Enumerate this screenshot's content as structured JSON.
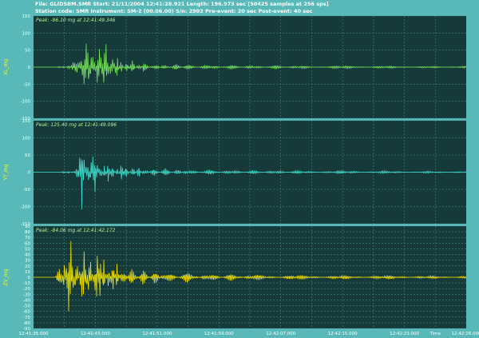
{
  "header": {
    "line1": "File: GLIDSBM.SMR  Start: 21/11/2004 12:41:28.921 Length: 196.973 sec [50425 samples at 256 sps]",
    "line2": "Station code: SMR  Instrument: SM-2 (00.06.00)  S/n: 2902  Pre-event: 20 sec  Post-event: 40 sec"
  },
  "colors": {
    "background": "#59b8b8",
    "panel": "#163a3a",
    "grid": "#3f8585",
    "xl": "#79e35c",
    "yt": "#40e0d0",
    "zv": "#f2e200",
    "label": "#eaff3a",
    "peak_text": "#b8f08a"
  },
  "chart_data": [
    {
      "type": "line",
      "ylabel": "XL_mg",
      "annotation": "Peak: -96.10 mg at 12:41:49.346",
      "ylim": [
        -150,
        150
      ],
      "yticks": [
        150,
        100,
        50,
        0,
        -50,
        -100,
        -150
      ],
      "series": [
        {
          "x": [
            0,
            10,
            12,
            14,
            16,
            18,
            19,
            20,
            21,
            22,
            23,
            24,
            25,
            26,
            27,
            28,
            29,
            30,
            31,
            32,
            33,
            34,
            35,
            36,
            37,
            38,
            40,
            42,
            45,
            48,
            50,
            55,
            60,
            65,
            70,
            80,
            90,
            100,
            110,
            120,
            140,
            160,
            180,
            197
          ],
          "y": [
            0,
            0,
            2,
            -5,
            10,
            -14,
            22,
            -45,
            42,
            -96,
            75,
            -80,
            85,
            -70,
            60,
            -80,
            90,
            -80,
            70,
            -92,
            95,
            -70,
            60,
            -50,
            40,
            -35,
            30,
            -25,
            20,
            -18,
            15,
            -12,
            10,
            -10,
            8,
            -8,
            7,
            -6,
            6,
            -5,
            5,
            -4,
            3,
            -3
          ]
        }
      ]
    },
    {
      "type": "line",
      "ylabel": "YT_mg",
      "annotation": "Peak: 125.40 mg at 12:41:49.096",
      "ylim": [
        -150,
        150
      ],
      "yticks": [
        150,
        100,
        50,
        0,
        -50,
        -100,
        -150
      ],
      "series": [
        {
          "x": [
            0,
            12,
            14,
            16,
            18,
            19,
            20,
            21,
            22,
            23,
            24,
            25,
            26,
            27,
            28,
            29,
            30,
            31,
            32,
            34,
            36,
            38,
            40,
            42,
            45,
            48,
            50,
            55,
            60,
            65,
            70,
            80,
            90,
            100,
            110,
            120,
            140,
            160,
            180,
            197
          ],
          "y": [
            0,
            0,
            3,
            -4,
            5,
            -6,
            30,
            -60,
            125,
            -90,
            80,
            -75,
            65,
            -55,
            60,
            -45,
            50,
            -40,
            35,
            -30,
            30,
            -25,
            28,
            -22,
            20,
            -18,
            15,
            -12,
            12,
            -10,
            9,
            -8,
            7,
            -6,
            6,
            -5,
            5,
            -4,
            3,
            -3
          ]
        }
      ]
    },
    {
      "type": "line",
      "ylabel": "ZV_mg",
      "annotation": "Peak: -84.06 mg at 12:41:42.172",
      "ylim": [
        -90,
        90
      ],
      "yticks": [
        90,
        80,
        70,
        60,
        50,
        40,
        30,
        20,
        10,
        0,
        -10,
        -20,
        -30,
        -40,
        -50,
        -60,
        -70,
        -80,
        -90
      ],
      "series": [
        {
          "x": [
            0,
            10,
            12,
            13,
            14,
            15,
            16,
            17,
            18,
            19,
            20,
            21,
            22,
            23,
            24,
            25,
            26,
            27,
            28,
            29,
            30,
            32,
            34,
            36,
            38,
            40,
            45,
            50,
            55,
            60,
            70,
            80,
            90,
            100,
            120,
            140,
            160,
            180,
            197
          ],
          "y": [
            0,
            0,
            -20,
            40,
            -84,
            60,
            -70,
            70,
            -50,
            55,
            -60,
            50,
            -45,
            60,
            -40,
            50,
            -55,
            45,
            -40,
            70,
            -50,
            45,
            -40,
            30,
            -28,
            25,
            -20,
            15,
            -14,
            12,
            -10,
            8,
            -7,
            6,
            -5,
            4,
            -4,
            3,
            -2
          ]
        }
      ]
    }
  ],
  "x_axis": {
    "ticks": [
      "12:41:35.000",
      "12:41:43.000",
      "12:41:51.000",
      "12:41:59.000",
      "12:42:07.000",
      "12:42:15.000",
      "12:42:23.000",
      "12:42:26.000"
    ],
    "title": "Time"
  }
}
